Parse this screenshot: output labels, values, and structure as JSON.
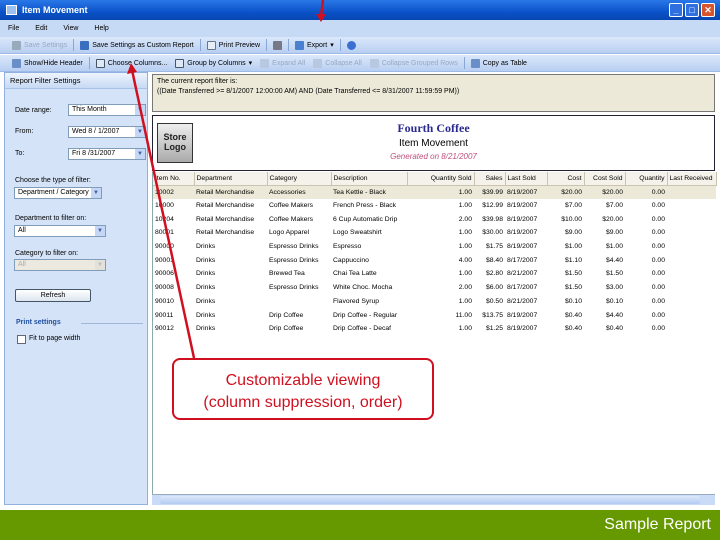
{
  "window": {
    "title": "Item Movement",
    "min": "_",
    "max": "□",
    "close": "✕"
  },
  "menu": [
    "File",
    "Edit",
    "View",
    "Help"
  ],
  "toolbar1": {
    "save_settings": "Save Settings",
    "save_custom": "Save Settings as Custom Report",
    "print_preview": "Print Preview",
    "export": "Export",
    "export_arrow": "▾"
  },
  "toolbar2": {
    "show_hide": "Show/Hide Header",
    "choose_columns": "Choose Columns...",
    "group_by": "Group by Columns",
    "group_arrow": "▾",
    "expand_all": "Expand All",
    "collapse_all": "Collapse All",
    "collapse_grouped": "Collapse Grouped Rows",
    "copy_table": "Copy as Table"
  },
  "filter_panel": {
    "title": "Report Filter Settings",
    "date_range_label": "Date range:",
    "date_range": "This Month",
    "from_label": "From:",
    "from": "Wed 8 / 1/2007",
    "to_label": "To:",
    "to": "Fri 8 /31/2007",
    "filter_type_label": "Choose the type of filter:",
    "filter_type": "Department / Category",
    "dept_label": "Department to filter on:",
    "dept": "All",
    "cat_label": "Category to filter on:",
    "cat": "All",
    "refresh": "Refresh",
    "print_settings": "Print settings",
    "fit_page": "Fit to page width"
  },
  "filter_text": {
    "line1": "The current report filter is:",
    "line2": "((Date Transferred >= 8/1/2007 12:00:00 AM) AND (Date Transferred <= 8/31/2007 11:59:59 PM))"
  },
  "report": {
    "logo": "Store Logo",
    "company": "Fourth Coffee",
    "title": "Item Movement",
    "generated": "Generated on 8/21/2007"
  },
  "table": {
    "columns": [
      "Item No.",
      "Department",
      "Category",
      "Description",
      "Quantity Sold",
      "Sales",
      "Last Sold",
      "Cost",
      "Cost Sold",
      "Quantity",
      "Last Received"
    ],
    "rows": [
      [
        "10002",
        "Retail Merchandise",
        "Accessories",
        "Tea Kettle - Black",
        "1.00",
        "$39.99",
        "8/19/2007",
        "$20.00",
        "$20.00",
        "0.00",
        ""
      ],
      [
        "10000",
        "Retail Merchandise",
        "Coffee Makers",
        "French Press - Black",
        "1.00",
        "$12.99",
        "8/19/2007",
        "$7.00",
        "$7.00",
        "0.00",
        ""
      ],
      [
        "10204",
        "Retail Merchandise",
        "Coffee Makers",
        "6 Cup Automatic Drip",
        "2.00",
        "$39.98",
        "8/19/2007",
        "$10.00",
        "$20.00",
        "0.00",
        ""
      ],
      [
        "80001",
        "Retail Merchandise",
        "Logo Apparel",
        "Logo Sweatshirt",
        "1.00",
        "$30.00",
        "8/19/2007",
        "$9.00",
        "$9.00",
        "0.00",
        ""
      ],
      [
        "90000",
        "Drinks",
        "Espresso Drinks",
        "Espresso",
        "1.00",
        "$1.75",
        "8/19/2007",
        "$1.00",
        "$1.00",
        "0.00",
        ""
      ],
      [
        "90001",
        "Drinks",
        "Espresso Drinks",
        "Cappuccino",
        "4.00",
        "$8.40",
        "8/17/2007",
        "$1.10",
        "$4.40",
        "0.00",
        ""
      ],
      [
        "90006",
        "Drinks",
        "Brewed Tea",
        "Chai Tea Latte",
        "1.00",
        "$2.80",
        "8/21/2007",
        "$1.50",
        "$1.50",
        "0.00",
        ""
      ],
      [
        "90008",
        "Drinks",
        "Espresso Drinks",
        "White Choc. Mocha",
        "2.00",
        "$6.00",
        "8/17/2007",
        "$1.50",
        "$3.00",
        "0.00",
        ""
      ],
      [
        "90010",
        "Drinks",
        "",
        "Flavored Syrup",
        "1.00",
        "$0.50",
        "8/21/2007",
        "$0.10",
        "$0.10",
        "0.00",
        ""
      ],
      [
        "90011",
        "Drinks",
        "Drip Coffee",
        "Drip Coffee - Regular",
        "11.00",
        "$13.75",
        "8/19/2007",
        "$0.40",
        "$4.40",
        "0.00",
        ""
      ],
      [
        "90012",
        "Drinks",
        "Drip Coffee",
        "Drip Coffee - Decaf",
        "1.00",
        "$1.25",
        "8/19/2007",
        "$0.40",
        "$0.40",
        "0.00",
        ""
      ]
    ]
  },
  "callout": {
    "line1": "Customizable viewing",
    "line2": "(column suppression, order)"
  },
  "footer": "Sample Report",
  "colors": {
    "footer": "#669900",
    "callout": "#d01020",
    "titlebar": "#0a52c8"
  }
}
